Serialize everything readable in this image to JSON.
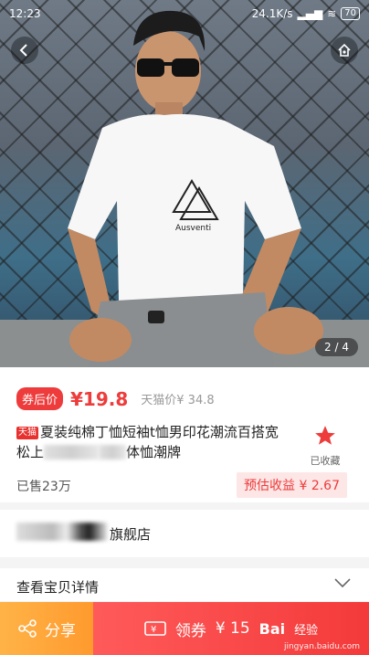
{
  "status_bar": {
    "time": "12:23",
    "speed": "24.1K/s",
    "battery": "70"
  },
  "hero": {
    "pager": "2 / 4",
    "shirt_brand": "Ausventi"
  },
  "price": {
    "badge": "券后价",
    "value": "¥19.8",
    "tmall_label": "天猫价¥ 34.8"
  },
  "product": {
    "tmall_tag": "天猫",
    "title_part1": "夏装纯棉丁恤短袖t恤男印花潮流百搭宽",
    "title_part2": "松上",
    "title_part3": "体恤潮牌",
    "favorite_label": "已收藏",
    "sold": "已售23万",
    "earn": "预估收益 ¥ 2.67"
  },
  "shop": {
    "name_suffix": "旗舰店"
  },
  "details": {
    "label": "查看宝贝详情"
  },
  "bottom": {
    "share_label": "分享",
    "coupon_label": "领券",
    "coupon_amount": "¥ 15",
    "watermark_brand": "Bai",
    "watermark_text": "经验",
    "watermark_url": "jingyan.baidu.com"
  },
  "colors": {
    "accent": "#ee3b3b",
    "share": "#ff9a2e",
    "coupon": "#f43a3a"
  }
}
